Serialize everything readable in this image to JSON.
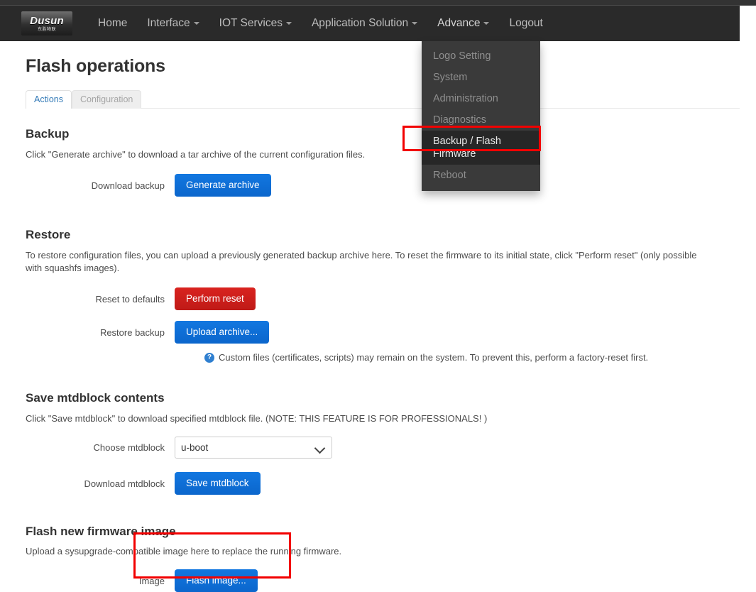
{
  "navbar": {
    "brand_name": "Dusun",
    "brand_sub": "东胜物联",
    "items": [
      {
        "label": "Home",
        "has_caret": false
      },
      {
        "label": "Interface",
        "has_caret": true
      },
      {
        "label": "IOT Services",
        "has_caret": true
      },
      {
        "label": "Application Solution",
        "has_caret": true
      },
      {
        "label": "Advance",
        "has_caret": true
      },
      {
        "label": "Logout",
        "has_caret": false
      }
    ]
  },
  "dropdown": {
    "items": [
      {
        "label": "Logo Setting",
        "selected": false
      },
      {
        "label": "System",
        "selected": false
      },
      {
        "label": "Administration",
        "selected": false
      },
      {
        "label": "Diagnostics",
        "selected": false
      },
      {
        "label": "Backup / Flash Firmware",
        "selected": true
      },
      {
        "label": "Reboot",
        "selected": false
      }
    ]
  },
  "page": {
    "title": "Flash operations"
  },
  "tabs": [
    {
      "label": "Actions",
      "active": true
    },
    {
      "label": "Configuration",
      "active": false
    }
  ],
  "backup": {
    "title": "Backup",
    "description": "Click \"Generate archive\" to download a tar archive of the current configuration files.",
    "field_label": "Download backup",
    "button_label": "Generate archive"
  },
  "restore": {
    "title": "Restore",
    "description": "To restore configuration files, you can upload a previously generated backup archive here. To reset the firmware to its initial state, click \"Perform reset\" (only possible with squashfs images).",
    "reset_label": "Reset to defaults",
    "reset_button": "Perform reset",
    "upload_label": "Restore backup",
    "upload_button": "Upload archive...",
    "hint_icon": "help-circle-icon",
    "hint": "Custom files (certificates, scripts) may remain on the system. To prevent this, perform a factory-reset first."
  },
  "mtdblock": {
    "title": "Save mtdblock contents",
    "description": "Click \"Save mtdblock\" to download specified mtdblock file. (NOTE: THIS FEATURE IS FOR PROFESSIONALS! )",
    "choose_label": "Choose mtdblock",
    "selected_option": "u-boot",
    "options": [
      "u-boot"
    ],
    "download_label": "Download mtdblock",
    "save_button": "Save mtdblock"
  },
  "flash": {
    "title": "Flash new firmware image",
    "description": "Upload a sysupgrade-compatible image here to replace the running firmware.",
    "image_label": "Image",
    "button_label": "Flash image..."
  },
  "colors": {
    "navbar_bg": "#2a2a2a",
    "accent_blue": "#0b66cc",
    "danger_red": "#bf1a17",
    "highlight_red": "#f20000",
    "tab_active_text": "#337ab7"
  }
}
